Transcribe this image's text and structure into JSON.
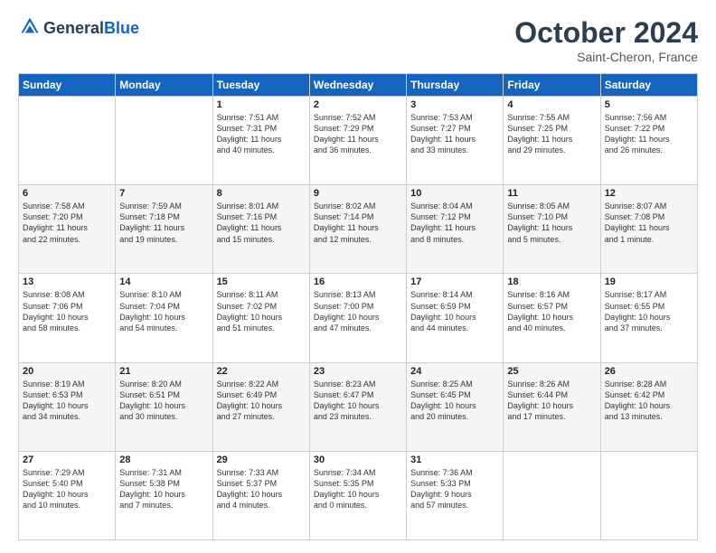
{
  "logo": {
    "general": "General",
    "blue": "Blue"
  },
  "header": {
    "month": "October 2024",
    "location": "Saint-Cheron, France"
  },
  "weekdays": [
    "Sunday",
    "Monday",
    "Tuesday",
    "Wednesday",
    "Thursday",
    "Friday",
    "Saturday"
  ],
  "weeks": [
    [
      {
        "day": "",
        "content": ""
      },
      {
        "day": "",
        "content": ""
      },
      {
        "day": "1",
        "content": "Sunrise: 7:51 AM\nSunset: 7:31 PM\nDaylight: 11 hours\nand 40 minutes."
      },
      {
        "day": "2",
        "content": "Sunrise: 7:52 AM\nSunset: 7:29 PM\nDaylight: 11 hours\nand 36 minutes."
      },
      {
        "day": "3",
        "content": "Sunrise: 7:53 AM\nSunset: 7:27 PM\nDaylight: 11 hours\nand 33 minutes."
      },
      {
        "day": "4",
        "content": "Sunrise: 7:55 AM\nSunset: 7:25 PM\nDaylight: 11 hours\nand 29 minutes."
      },
      {
        "day": "5",
        "content": "Sunrise: 7:56 AM\nSunset: 7:22 PM\nDaylight: 11 hours\nand 26 minutes."
      }
    ],
    [
      {
        "day": "6",
        "content": "Sunrise: 7:58 AM\nSunset: 7:20 PM\nDaylight: 11 hours\nand 22 minutes."
      },
      {
        "day": "7",
        "content": "Sunrise: 7:59 AM\nSunset: 7:18 PM\nDaylight: 11 hours\nand 19 minutes."
      },
      {
        "day": "8",
        "content": "Sunrise: 8:01 AM\nSunset: 7:16 PM\nDaylight: 11 hours\nand 15 minutes."
      },
      {
        "day": "9",
        "content": "Sunrise: 8:02 AM\nSunset: 7:14 PM\nDaylight: 11 hours\nand 12 minutes."
      },
      {
        "day": "10",
        "content": "Sunrise: 8:04 AM\nSunset: 7:12 PM\nDaylight: 11 hours\nand 8 minutes."
      },
      {
        "day": "11",
        "content": "Sunrise: 8:05 AM\nSunset: 7:10 PM\nDaylight: 11 hours\nand 5 minutes."
      },
      {
        "day": "12",
        "content": "Sunrise: 8:07 AM\nSunset: 7:08 PM\nDaylight: 11 hours\nand 1 minute."
      }
    ],
    [
      {
        "day": "13",
        "content": "Sunrise: 8:08 AM\nSunset: 7:06 PM\nDaylight: 10 hours\nand 58 minutes."
      },
      {
        "day": "14",
        "content": "Sunrise: 8:10 AM\nSunset: 7:04 PM\nDaylight: 10 hours\nand 54 minutes."
      },
      {
        "day": "15",
        "content": "Sunrise: 8:11 AM\nSunset: 7:02 PM\nDaylight: 10 hours\nand 51 minutes."
      },
      {
        "day": "16",
        "content": "Sunrise: 8:13 AM\nSunset: 7:00 PM\nDaylight: 10 hours\nand 47 minutes."
      },
      {
        "day": "17",
        "content": "Sunrise: 8:14 AM\nSunset: 6:59 PM\nDaylight: 10 hours\nand 44 minutes."
      },
      {
        "day": "18",
        "content": "Sunrise: 8:16 AM\nSunset: 6:57 PM\nDaylight: 10 hours\nand 40 minutes."
      },
      {
        "day": "19",
        "content": "Sunrise: 8:17 AM\nSunset: 6:55 PM\nDaylight: 10 hours\nand 37 minutes."
      }
    ],
    [
      {
        "day": "20",
        "content": "Sunrise: 8:19 AM\nSunset: 6:53 PM\nDaylight: 10 hours\nand 34 minutes."
      },
      {
        "day": "21",
        "content": "Sunrise: 8:20 AM\nSunset: 6:51 PM\nDaylight: 10 hours\nand 30 minutes."
      },
      {
        "day": "22",
        "content": "Sunrise: 8:22 AM\nSunset: 6:49 PM\nDaylight: 10 hours\nand 27 minutes."
      },
      {
        "day": "23",
        "content": "Sunrise: 8:23 AM\nSunset: 6:47 PM\nDaylight: 10 hours\nand 23 minutes."
      },
      {
        "day": "24",
        "content": "Sunrise: 8:25 AM\nSunset: 6:45 PM\nDaylight: 10 hours\nand 20 minutes."
      },
      {
        "day": "25",
        "content": "Sunrise: 8:26 AM\nSunset: 6:44 PM\nDaylight: 10 hours\nand 17 minutes."
      },
      {
        "day": "26",
        "content": "Sunrise: 8:28 AM\nSunset: 6:42 PM\nDaylight: 10 hours\nand 13 minutes."
      }
    ],
    [
      {
        "day": "27",
        "content": "Sunrise: 7:29 AM\nSunset: 5:40 PM\nDaylight: 10 hours\nand 10 minutes."
      },
      {
        "day": "28",
        "content": "Sunrise: 7:31 AM\nSunset: 5:38 PM\nDaylight: 10 hours\nand 7 minutes."
      },
      {
        "day": "29",
        "content": "Sunrise: 7:33 AM\nSunset: 5:37 PM\nDaylight: 10 hours\nand 4 minutes."
      },
      {
        "day": "30",
        "content": "Sunrise: 7:34 AM\nSunset: 5:35 PM\nDaylight: 10 hours\nand 0 minutes."
      },
      {
        "day": "31",
        "content": "Sunrise: 7:36 AM\nSunset: 5:33 PM\nDaylight: 9 hours\nand 57 minutes."
      },
      {
        "day": "",
        "content": ""
      },
      {
        "day": "",
        "content": ""
      }
    ]
  ]
}
